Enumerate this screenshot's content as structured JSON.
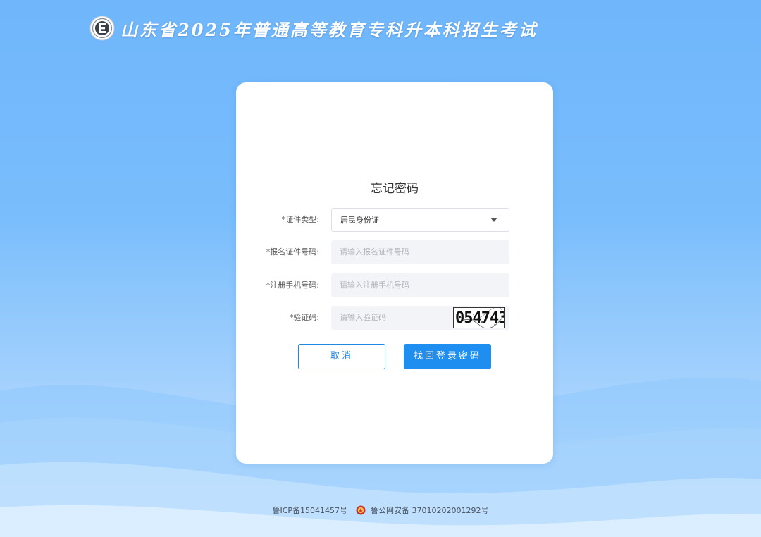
{
  "header": {
    "title": "山东省2025年普通高等教育专科升本科招生考试"
  },
  "form": {
    "title": "忘记密码",
    "id_type": {
      "label": "*证件类型:",
      "value": "居民身份证"
    },
    "id_number": {
      "label": "*报名证件号码:",
      "placeholder": "请输入报名证件号码"
    },
    "phone": {
      "label": "*注册手机号码:",
      "placeholder": "请输入注册手机号码"
    },
    "captcha": {
      "label": "*验证码:",
      "placeholder": "请输入验证码",
      "image_text": "054743"
    },
    "cancel_label": "取消",
    "submit_label": "找回登录密码"
  },
  "footer": {
    "icp": "鲁ICP备15041457号",
    "police": "鲁公网安备 37010202001292号"
  },
  "colors": {
    "primary": "#1e8ff0",
    "background": "#6fb6fb"
  }
}
